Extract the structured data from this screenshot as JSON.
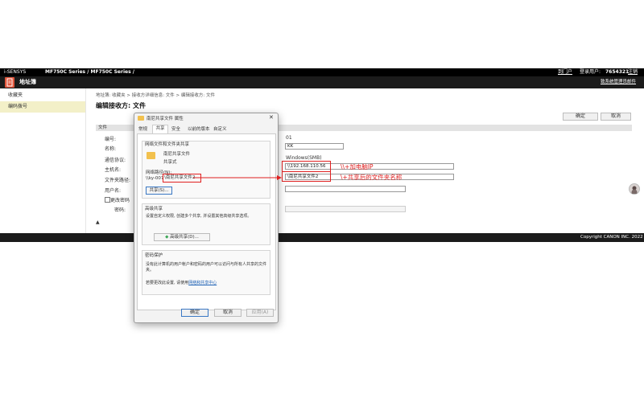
{
  "topbar": {
    "product": "i-SENSYS",
    "model": "MF750C Series / MF750C Series /",
    "portal": "到门户",
    "login_user_label": "登录用户:",
    "login_user": "7654321",
    "logout": "注销"
  },
  "titlebar": {
    "title": "地址簿",
    "admin_link": "致系统管理员邮件"
  },
  "sidebar": {
    "items": [
      {
        "label": "收藏夹"
      },
      {
        "label": "编码拨号"
      }
    ]
  },
  "main": {
    "breadcrumb": "地址簿: 收藏夹 > 接收方详细信息: 文件 > 编辑接收方: 文件",
    "heading": "编辑接收方: 文件",
    "ok": "确定",
    "cancel": "取消",
    "section": "文件",
    "labels": {
      "number": "编号:",
      "name": "名称:",
      "protocol": "通信协议:",
      "host": "主机名:",
      "path": "文件夹路径:",
      "user": "用户名:",
      "change_pw": "更改密码",
      "password": "密码:"
    },
    "values": {
      "number": "01",
      "name": "KK",
      "protocol": "Windows(SMB)",
      "host": "\\\\192.168.110.56",
      "path": "\\南尼共享文件2"
    },
    "annotation_ip": "\\\\+加电脑IP",
    "annotation_folder": "\\+共享后的文件夹名称",
    "scroll_top": "▲"
  },
  "footer": {
    "copyright": "Copyright CANON INC. 2022"
  },
  "dialog": {
    "title": "南尼共享文件 属性",
    "tabs": [
      "常规",
      "共享",
      "安全",
      "以前的版本",
      "自定义"
    ],
    "network_group_title": "网络文件和文件夹共享",
    "folder_name": "南尼共享文件",
    "folder_status": "共享式",
    "network_path_label": "网络路径(N):",
    "network_path_prefix": "\\\\ky-007",
    "network_path_highlight": "\\南尼共享文件2",
    "share_button": "共享(S)...",
    "advanced_group_title": "高级共享",
    "advanced_desc": "设置自定义权限, 创建多个共享, 并设置其他高级共享选项。",
    "advanced_button": "高级共享(D)...",
    "password_group_title": "密码保护",
    "password_desc": "没有此计算机的用户帐户和密码的用户可以访问与所有人共享的文件夹。",
    "password_change_prefix": "若要更改此设置, 请使用",
    "password_link": "网络和共享中心",
    "ok": "确定",
    "cancel": "取消",
    "apply": "应用(A)"
  }
}
